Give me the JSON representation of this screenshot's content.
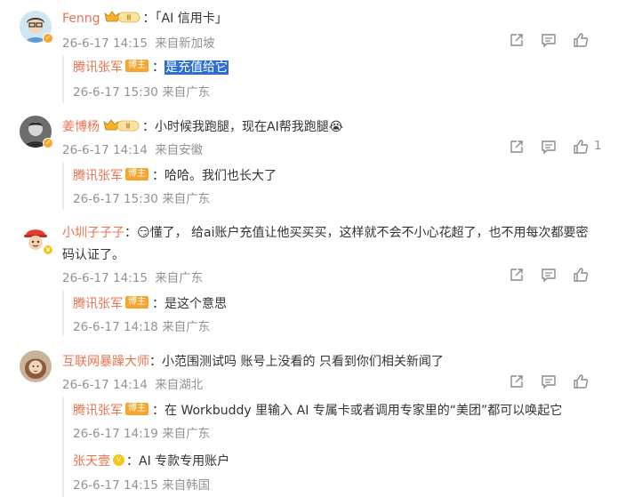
{
  "comments": [
    {
      "name": "Fenng",
      "text": "：「AI 信用卡」",
      "time": "26-6-17 14:15",
      "loc": "来自新加坡",
      "likes": "",
      "replies": [
        {
          "name": "腾讯张军",
          "badge": "博主",
          "sep": "：",
          "text": "是充值给它",
          "time": "26-6-17 15:30",
          "loc": "来自广东"
        }
      ]
    },
    {
      "name": "姜博杨",
      "text": "：小时候我跑腿，现在AI帮我跑腿😭",
      "time": "26-6-17 14:14",
      "loc": "来自安徽",
      "likes": "1",
      "replies": [
        {
          "name": "腾讯张军",
          "badge": "博主",
          "sep": "：",
          "text": "哈哈。我们也长大了",
          "time": "26-6-17 15:30",
          "loc": "来自广东"
        }
      ]
    },
    {
      "name": "小圳子子子",
      "text_line1": "：😏懂了， 给ai账户充值让他买买买，这样就不会不小心花超了，也不用每次都要密",
      "text_line2": "码认证了。",
      "time": "26-6-17 14:15",
      "loc": "来自广东",
      "likes": "",
      "replies": [
        {
          "name": "腾讯张军",
          "badge": "博主",
          "sep": "：",
          "text": "是这个意思",
          "time": "26-6-17 14:18",
          "loc": "来自广东"
        }
      ]
    },
    {
      "name": "互联网暴躁大师",
      "text": "：小范围测试吗 账号上没看的 只看到你们相关新闻了",
      "time": "26-6-17 14:14",
      "loc": "来自湖北",
      "likes": "",
      "replies": [
        {
          "name": "腾讯张军",
          "badge": "博主",
          "sep": "：",
          "text": "在 Workbuddy 里输入 AI 专属卡或者调用专家里的“美团”都可以唤起它",
          "time": "26-6-17 14:19",
          "loc": "来自广东"
        },
        {
          "name": "张天壹",
          "sep": "：",
          "text": "AI 专款专用账户",
          "time": "26-6-17 14:15",
          "loc": "来自韩国"
        }
      ]
    }
  ],
  "colors": {
    "name": "#eb7350",
    "meta": "#939393",
    "highlight": "#2d6ed3",
    "badge": "#f7a52c"
  },
  "icons": [
    "share-icon",
    "comment-icon",
    "like-icon",
    "crown-level-icon",
    "verified-badge-icon"
  ]
}
